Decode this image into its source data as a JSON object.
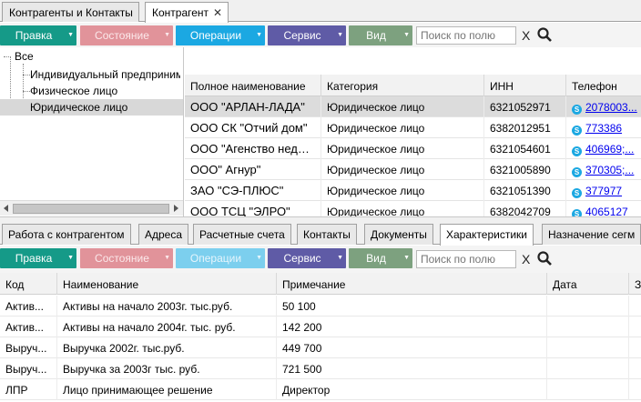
{
  "top_tabs": [
    {
      "label": "Контрагенты и Контакты"
    },
    {
      "label": "Контрагент",
      "close": "✕"
    }
  ],
  "toolbar1": {
    "buttons": [
      {
        "label": "Правка"
      },
      {
        "label": "Состояние"
      },
      {
        "label": "Операции"
      },
      {
        "label": "Сервис"
      },
      {
        "label": "Вид"
      }
    ],
    "search_placeholder": "Поиск по полю",
    "clear": "X"
  },
  "tree": {
    "root": "Все",
    "items": [
      {
        "label": "Индивидуальный предприниматель"
      },
      {
        "label": "Физическое лицо"
      },
      {
        "label": "Юридическое лицо"
      }
    ]
  },
  "grid": {
    "columns": [
      "Полное наименование",
      "Категория",
      "ИНН",
      "Телефон"
    ],
    "rows": [
      {
        "name": "ООО \"АРЛАН-ЛАДА\"",
        "category": "Юридическое лицо",
        "inn": "6321052971",
        "phone": "2078003..."
      },
      {
        "name": "ООО СК \"Отчий дом\"",
        "category": "Юридическое лицо",
        "inn": "6382012951",
        "phone": "773386"
      },
      {
        "name": "ООО \"Агенство недвижимости\"",
        "category": "Юридическое лицо",
        "inn": "6321054601",
        "phone": "406969;..."
      },
      {
        "name": "ООО\" Агнур\"",
        "category": "Юридическое лицо",
        "inn": "6321005890",
        "phone": "370305;..."
      },
      {
        "name": "ЗАО \"СЭ-ПЛЮС\"",
        "category": "Юридическое лицо",
        "inn": "6321051390",
        "phone": "377977"
      },
      {
        "name": "ООО ТСЦ \"ЭЛРО\"",
        "category": "Юридическое лицо",
        "inn": "6382042709",
        "phone": "4065127"
      }
    ]
  },
  "bottom_tabs": [
    {
      "label": "Работа с контрагентом"
    },
    {
      "label": "Адреса"
    },
    {
      "label": "Расчетные счета"
    },
    {
      "label": "Контакты"
    },
    {
      "label": "Документы"
    },
    {
      "label": "Характеристики"
    },
    {
      "label": "Назначение сегм"
    }
  ],
  "toolbar2": {
    "buttons": [
      {
        "label": "Правка"
      },
      {
        "label": "Состояние"
      },
      {
        "label": "Операции"
      },
      {
        "label": "Сервис"
      },
      {
        "label": "Вид"
      }
    ],
    "search_placeholder": "Поиск по полю",
    "clear": "X"
  },
  "bgrid": {
    "columns": [
      "Код",
      "Наименование",
      "Примечание",
      "Дата",
      "З"
    ],
    "rows": [
      {
        "code": "Актив...",
        "name": "Активы на начало 2003г. тыс.руб.",
        "note": "50 100",
        "date": ""
      },
      {
        "code": "Актив...",
        "name": "Активы на начало 2004г. тыс. руб.",
        "note": "142 200",
        "date": ""
      },
      {
        "code": "Выруч...",
        "name": "Выручка 2002г. тыс.руб.",
        "note": "449 700",
        "date": ""
      },
      {
        "code": "Выруч...",
        "name": "Выручка за 2003г тыс. руб.",
        "note": "721 500",
        "date": ""
      },
      {
        "code": "ЛПР",
        "name": "Лицо принимающее решение",
        "note": "Директор",
        "date": ""
      }
    ]
  }
}
